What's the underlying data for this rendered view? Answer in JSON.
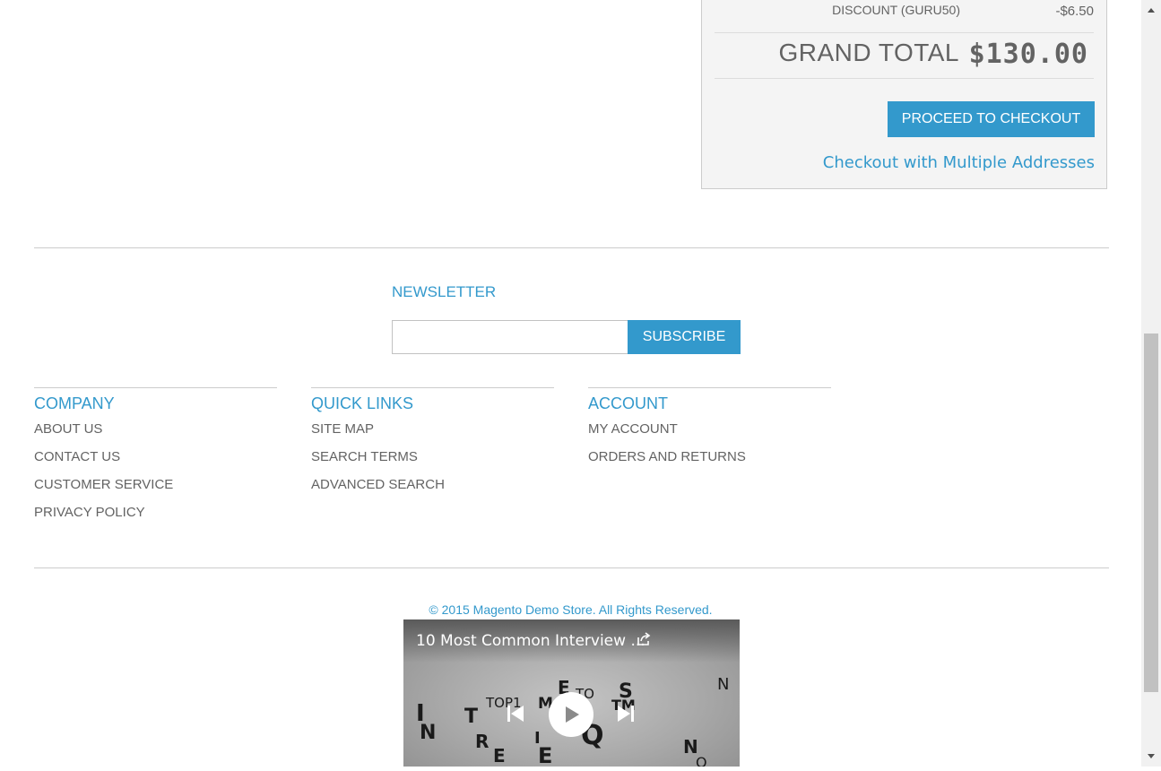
{
  "totals": {
    "discount_label": "DISCOUNT (GURU50)",
    "discount_value": "-$6.50",
    "grand_total_label": "GRAND TOTAL",
    "grand_total_value": "$130.00",
    "checkout_button": "PROCEED TO CHECKOUT",
    "multi_address_link": "Checkout with Multiple Addresses"
  },
  "newsletter": {
    "title": "NEWSLETTER",
    "input_value": "",
    "subscribe_button": "SUBSCRIBE"
  },
  "footer": {
    "company": {
      "title": "COMPANY",
      "links": [
        "ABOUT US",
        "CONTACT US",
        "CUSTOMER SERVICE",
        "PRIVACY POLICY"
      ]
    },
    "quick_links": {
      "title": "QUICK LINKS",
      "links": [
        "SITE MAP",
        "SEARCH TERMS",
        "ADVANCED SEARCH"
      ]
    },
    "account": {
      "title": "ACCOUNT",
      "links": [
        "MY ACCOUNT",
        "ORDERS AND RETURNS"
      ]
    },
    "copyright": "© 2015 Magento Demo Store. All Rights Reserved."
  },
  "video": {
    "title": "10 Most Common Interview ...",
    "icons": [
      "share-icon",
      "previous-icon",
      "play-icon",
      "next-icon"
    ]
  },
  "colors": {
    "accent": "#3399cc",
    "text": "#636363",
    "totals_background": "#f4f4f4"
  }
}
